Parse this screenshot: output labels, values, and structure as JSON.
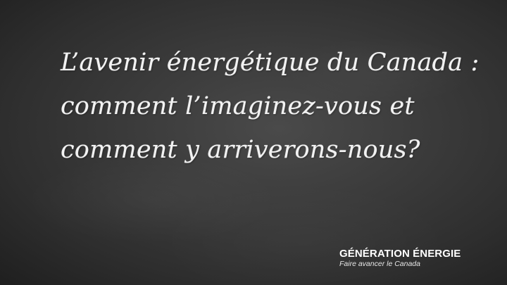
{
  "slide": {
    "headline_lines": [
      "L’avenir énergétique du Canada :",
      "comment l’imaginez-vous et",
      "comment y arriverons-nous?"
    ],
    "brand_name": "GÉNÉRATION ÉNERGIE",
    "brand_tagline": "Faire avancer le Canada",
    "background_color": "#3a3a3a",
    "text_color": "#f2f2f2"
  }
}
